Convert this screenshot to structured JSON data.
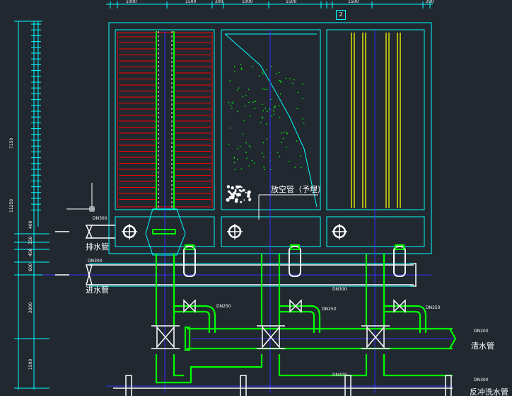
{
  "labels": {
    "drain_pipe": "排水管",
    "inlet_pipe": "进水管",
    "air_release_pipe": "放空管（予埋）",
    "clean_water_pipe": "清水管",
    "backwash_pipe": "反冲洗水管",
    "tank_index": "2"
  },
  "pipe_sizes": {
    "drain": "DN300",
    "inlet": "DN300",
    "clean_water": "DN200",
    "backwash": "DN300",
    "main_a": "DN300",
    "main_b": "DN300",
    "branch_1": "DN250",
    "branch_2": "DN250",
    "branch_3": "DN250"
  },
  "dimensions": {
    "total_height": "11250",
    "upper_height": "7150",
    "seg_2000": "2000",
    "seg_1500": "1500",
    "seg_600": "600",
    "seg_450": "450",
    "seg_350": "350",
    "seg_400": "400",
    "top_spans": [
      "1000",
      "1500",
      "200",
      "1000",
      "1500",
      "1500",
      "200",
      "1500",
      "200"
    ]
  },
  "colors": {
    "background": "#212830",
    "outline": "#00ffff",
    "pipe_main": "#00ff00",
    "pipe_process": "#ffffff",
    "heater_lines": "#ff0000",
    "vertical_rods": "#ffff00",
    "axis_lines": "#0000ff"
  }
}
